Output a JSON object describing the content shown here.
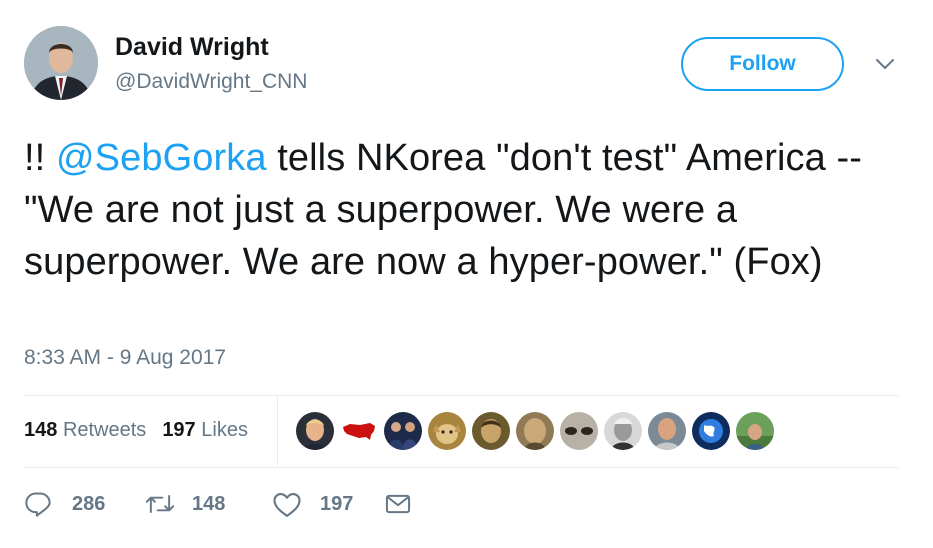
{
  "user": {
    "name": "David Wright",
    "handle": "@DavidWright_CNN",
    "follow_label": "Follow"
  },
  "tweet": {
    "text_prefix": "!! ",
    "mention": "@SebGorka",
    "text_rest": " tells NKorea \"don't test\" America -- \"We are not just a superpower. We were a superpower. We are now a hyper-power.\" (Fox)",
    "timestamp": "8:33 AM - 9 Aug 2017"
  },
  "stats": {
    "retweets_count": "148",
    "retweets_label": "Retweets",
    "likes_count": "197",
    "likes_label": "Likes"
  },
  "likers": [
    {
      "icon": "trump-avatar"
    },
    {
      "icon": "us-map-avatar"
    },
    {
      "icon": "group-photo-avatar"
    },
    {
      "icon": "dog-avatar"
    },
    {
      "icon": "portrait-avatar"
    },
    {
      "icon": "painting-avatar"
    },
    {
      "icon": "eyes-avatar"
    },
    {
      "icon": "bw-portrait-avatar"
    },
    {
      "icon": "man-avatar"
    },
    {
      "icon": "globe-avatar"
    },
    {
      "icon": "outdoor-avatar"
    }
  ],
  "actions": {
    "reply_count": "286",
    "retweet_count": "148",
    "like_count": "197"
  },
  "colors": {
    "accent": "#1da1f2",
    "secondary_text": "#657786",
    "primary_text": "#14171a",
    "divider": "#e6ecf0"
  }
}
